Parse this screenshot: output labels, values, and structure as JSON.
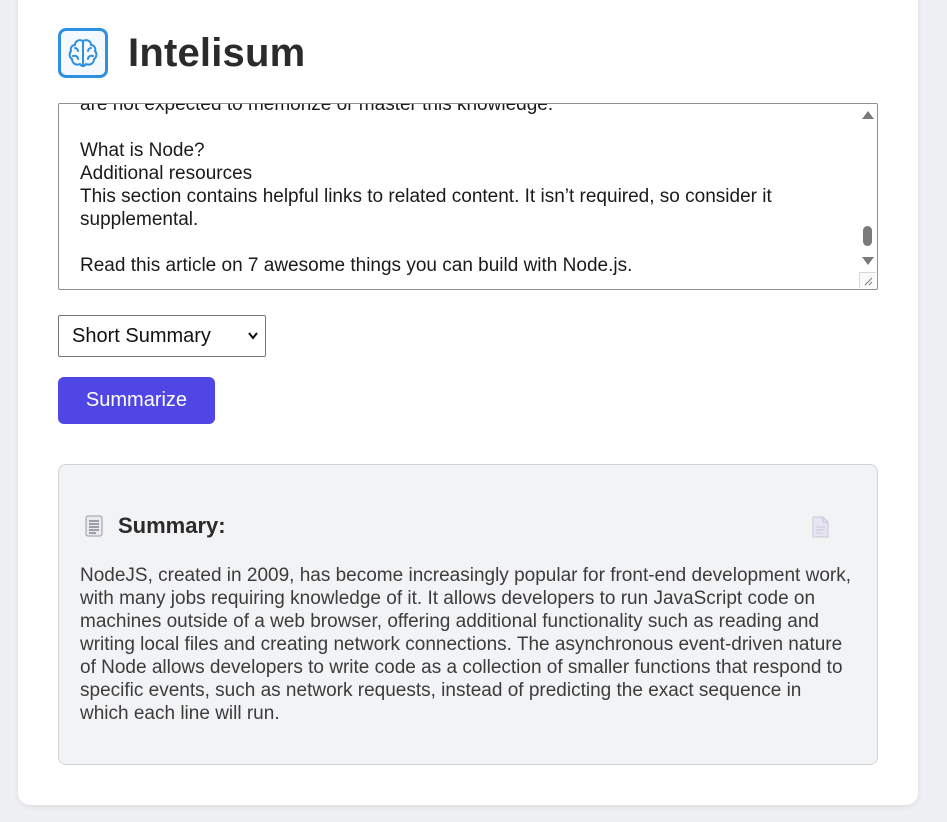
{
  "app": {
    "title": "Intelisum",
    "logo_icon": "brain-icon",
    "accent_color": "#4f46e5",
    "logo_color": "#2f8fe0"
  },
  "input": {
    "text": "are not expected to memorize or master this knowledge.\n\nWhat is Node?\nAdditional resources\nThis section contains helpful links to related content. It isn’t required, so consider it supplemental.\n\nRead this article on 7 awesome things you can build with Node.js."
  },
  "options": {
    "selected": "Short Summary"
  },
  "actions": {
    "summarize_label": "Summarize"
  },
  "summary": {
    "icon": "document-icon",
    "heading": "Summary:",
    "copy_icon": "copy-icon",
    "text": "NodeJS, created in 2009, has become increasingly popular for front-end development work, with many jobs requiring knowledge of it. It allows developers to run JavaScript code on machines outside of a web browser, offering additional functionality such as reading and writing local files and creating network connections. The asynchronous event-driven nature of Node allows developers to write code as a collection of smaller functions that respond to specific events, such as network requests, instead of predicting the exact sequence in which each line will run."
  }
}
